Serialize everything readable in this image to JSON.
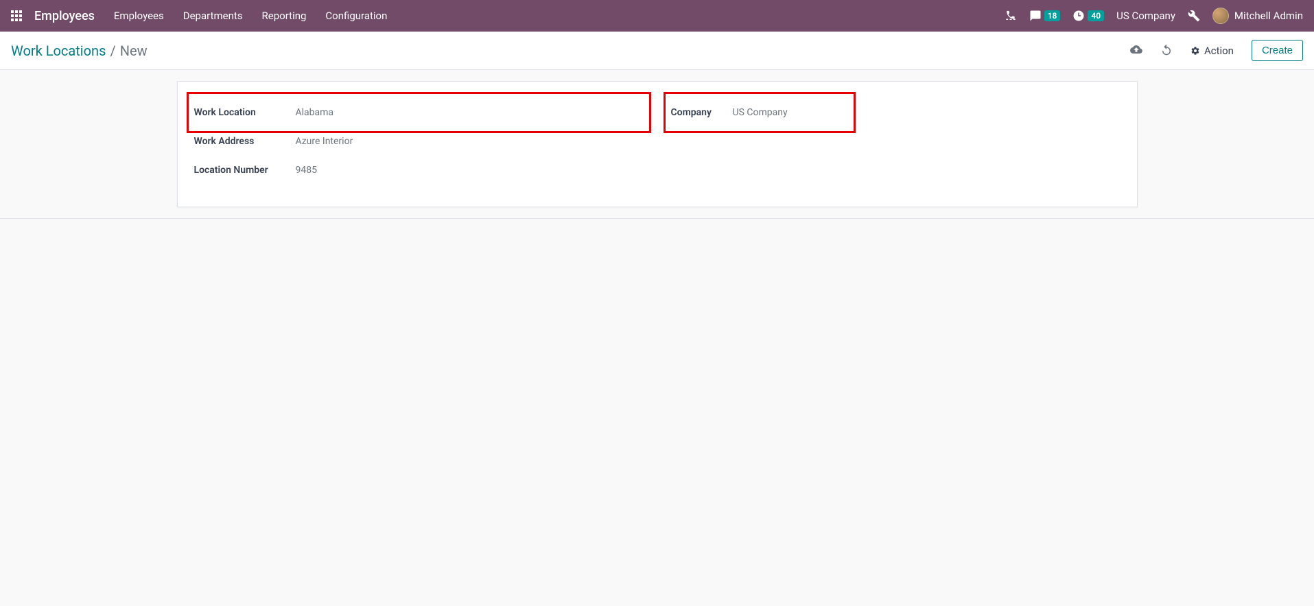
{
  "topnav": {
    "app_title": "Employees",
    "links": [
      "Employees",
      "Departments",
      "Reporting",
      "Configuration"
    ],
    "messages_badge": "18",
    "activities_badge": "40",
    "company": "US Company",
    "user_name": "Mitchell Admin"
  },
  "controlbar": {
    "breadcrumb_root": "Work Locations",
    "breadcrumb_sep": "/",
    "breadcrumb_current": "New",
    "action_label": "Action",
    "create_label": "Create"
  },
  "form": {
    "left": {
      "work_location_label": "Work Location",
      "work_location_value": "Alabama",
      "work_address_label": "Work Address",
      "work_address_value": "Azure Interior",
      "location_number_label": "Location Number",
      "location_number_value": "9485"
    },
    "right": {
      "company_label": "Company",
      "company_value": "US Company"
    }
  }
}
